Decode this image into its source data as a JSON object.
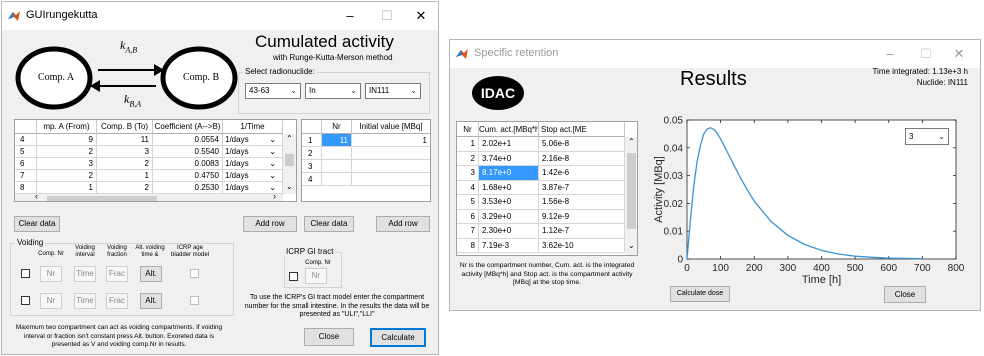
{
  "win1": {
    "title": "GUIrungekutta",
    "header_title": "Cumulated activity",
    "header_subtitle": "with Runge-Kutta-Merson method",
    "comp_a": "Comp. A",
    "comp_b": "Comp. B",
    "k_ab_base": "k",
    "k_ab_sub": "A,B",
    "k_ba_base": "k",
    "k_ba_sub": "B,A",
    "radionuclide_label": "Select radionuclide:",
    "radionuclide_selects": [
      "43-63",
      "In",
      "IN111"
    ],
    "transfer_table": {
      "columns": [
        "mp. A (From)",
        "Comp. B (To)",
        "Coefficient (A-->B)",
        "1/Time"
      ],
      "rows": [
        {
          "n": "4",
          "a": "9",
          "b": "11",
          "coef": "0.0554",
          "unit": "1/days"
        },
        {
          "n": "5",
          "a": "2",
          "b": "3",
          "coef": "0.5540",
          "unit": "1/days"
        },
        {
          "n": "6",
          "a": "3",
          "b": "2",
          "coef": "0.0083",
          "unit": "1/days"
        },
        {
          "n": "7",
          "a": "2",
          "b": "1",
          "coef": "0.4750",
          "unit": "1/days"
        },
        {
          "n": "8",
          "a": "1",
          "b": "2",
          "coef": "0.2530",
          "unit": "1/days"
        }
      ]
    },
    "initial_table": {
      "columns": [
        "Nr",
        "Initial value [MBq]"
      ],
      "rows": [
        {
          "n": "1",
          "nr": "11",
          "val": "1"
        },
        {
          "n": "2",
          "nr": "",
          "val": ""
        },
        {
          "n": "3",
          "nr": "",
          "val": ""
        },
        {
          "n": "4",
          "nr": "",
          "val": ""
        }
      ]
    },
    "clear_data_1": "Clear data",
    "add_row_1": "Add row",
    "clear_data_2": "Clear data",
    "add_row_2": "Add row",
    "voiding": {
      "label": "Voiding",
      "col_comp_nr": "Comp. Nr",
      "col_interval": "Voiding interval",
      "col_fraction": "Voiding fraction",
      "col_alt": "Alt. voiding time &",
      "col_icrp": "ICRP age bladder model",
      "rows": [
        {
          "nr": "Nr",
          "time": "Time",
          "frac": "Frac",
          "alt": "Alt."
        },
        {
          "nr": "Nr",
          "time": "Time",
          "frac": "Frac",
          "alt": "Alt."
        }
      ]
    },
    "gi": {
      "label": "ICRP GI tract",
      "comp_nr": "Comp. Nr",
      "nr": "Nr",
      "info": "To use the ICRP's GI tract model enter the compartment number for the small intestine. In the results the data will be presented as \"ULI\",\"LLI\""
    },
    "footer_note": "Maximum two compartment can act as voiding compartments. If voiding interval or fraction isn't constant press Alt. button. Exoreted data is presented as V and voiding comp.Nr in results.",
    "close": "Close",
    "calculate": "Calculate"
  },
  "win2": {
    "title": "Specific retention",
    "logo": "IDAC",
    "results_title": "Results",
    "time_integrated": "Time integrated: 1.13e+3 h",
    "nuclide": "Nuclide: IN111",
    "table": {
      "columns": [
        "Nr",
        "Cum. act.[MBq*h]",
        "Stop act.[ME"
      ],
      "rows": [
        {
          "nr": "1",
          "cum": "2.02e+1",
          "stop": "5.06e-8"
        },
        {
          "nr": "2",
          "cum": "3.74e+0",
          "stop": "2.16e-8"
        },
        {
          "nr": "3",
          "cum": "8.17e+0",
          "stop": "1.42e-6"
        },
        {
          "nr": "4",
          "cum": "1.68e+0",
          "stop": "3.87e-7"
        },
        {
          "nr": "5",
          "cum": "3.53e+0",
          "stop": "1.56e-8"
        },
        {
          "nr": "6",
          "cum": "3.29e+0",
          "stop": "9.12e-9"
        },
        {
          "nr": "7",
          "cum": "2.30e+0",
          "stop": "1.12e-7"
        },
        {
          "nr": "8",
          "cum": "7.19e-3",
          "stop": "3.62e-10"
        }
      ],
      "selected_row": 3
    },
    "table_note": "Nr is the compartment number, Cum. act. is the integrated activity [MBq*h] and Stop act. is the compartment activity [MBq] at the stop time.",
    "compartment_select": "3",
    "calculate_dose": "Calculate dose",
    "close": "Close",
    "accent": "#3399ff",
    "line_color": "#3d93d1"
  },
  "chart_data": {
    "type": "line",
    "title": "",
    "xlabel": "Time [h]",
    "ylabel": "Activity [MBq]",
    "xlim": [
      0,
      800
    ],
    "ylim": [
      0,
      0.05
    ],
    "xticks": [
      0,
      100,
      200,
      300,
      400,
      500,
      600,
      700,
      800
    ],
    "yticks": [
      0,
      0.01,
      0.02,
      0.03,
      0.04,
      0.05
    ],
    "grid": false,
    "x": [
      0,
      10,
      20,
      30,
      40,
      50,
      60,
      70,
      80,
      90,
      100,
      120,
      140,
      160,
      180,
      200,
      250,
      300,
      350,
      400,
      450,
      500,
      550,
      600,
      650,
      700
    ],
    "y": [
      0,
      0.014,
      0.026,
      0.035,
      0.041,
      0.045,
      0.0468,
      0.0472,
      0.0466,
      0.0452,
      0.0432,
      0.0385,
      0.0336,
      0.029,
      0.0247,
      0.0208,
      0.0135,
      0.0085,
      0.0052,
      0.0031,
      0.0018,
      0.001,
      0.0006,
      0.0003,
      0.0002,
      0.0001
    ]
  }
}
